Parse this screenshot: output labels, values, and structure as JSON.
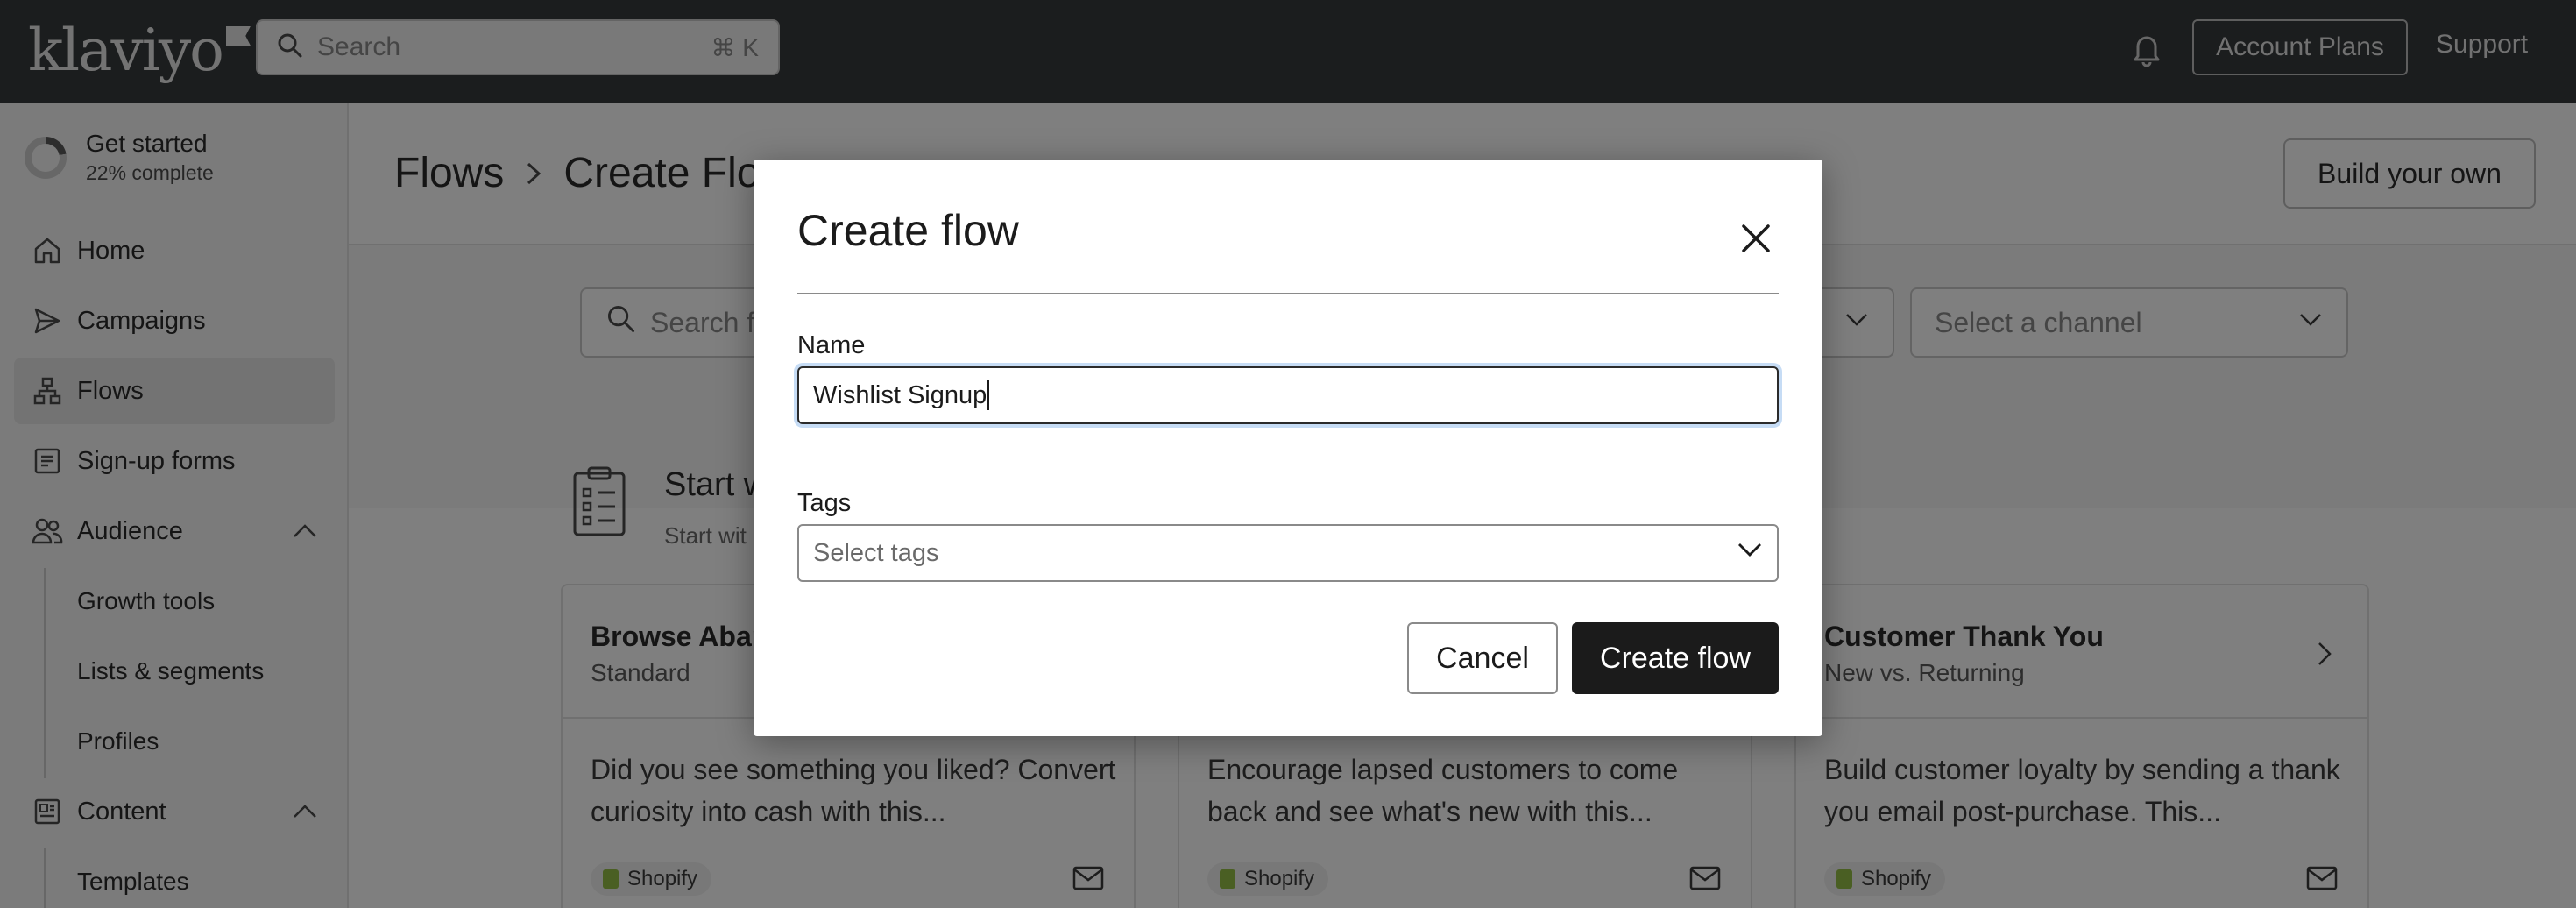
{
  "topbar": {
    "logo_text": "klaviyo",
    "search_placeholder": "Search",
    "search_shortcut": "⌘ K",
    "account_plans_label": "Account Plans",
    "support_label": "Support",
    "icons": {
      "search": "search-icon",
      "bell": "bell-icon"
    }
  },
  "sidebar": {
    "get_started": {
      "title": "Get started",
      "subtitle": "22% complete",
      "progress": 0.22
    },
    "items": [
      {
        "label": "Home",
        "icon": "home-icon"
      },
      {
        "label": "Campaigns",
        "icon": "send-icon"
      },
      {
        "label": "Flows",
        "icon": "flows-icon",
        "active": true
      },
      {
        "label": "Sign-up forms",
        "icon": "form-icon"
      },
      {
        "label": "Audience",
        "icon": "audience-icon",
        "expanded": true
      },
      {
        "label": "Content",
        "icon": "content-icon",
        "expanded": true
      }
    ],
    "audience_sub": [
      "Growth tools",
      "Lists & segments",
      "Profiles"
    ],
    "content_sub": [
      "Templates"
    ]
  },
  "main": {
    "breadcrumb": [
      "Flows",
      "Create Flo"
    ],
    "build_own_label": "Build your own",
    "filters": {
      "search_placeholder": "Search f",
      "dropdown1_partial": "s",
      "channel_placeholder": "Select a channel"
    },
    "start_title": "Start w",
    "start_sub": "Start wit",
    "cards": [
      {
        "title": "Browse Abar",
        "subtitle": "Standard",
        "desc": "Did you see something you liked? Convert curiosity into cash with this...",
        "badge": "Shopify"
      },
      {
        "title": "",
        "subtitle": "",
        "desc": "Encourage lapsed customers to come back and see what's new with this...",
        "badge": "Shopify"
      },
      {
        "title": "Customer Thank You",
        "subtitle": "New vs. Returning",
        "desc": "Build customer loyalty by sending a thank you email post-purchase. This...",
        "badge": "Shopify"
      }
    ]
  },
  "modal": {
    "title": "Create flow",
    "name_label": "Name",
    "name_value": "Wishlist Signup",
    "tags_label": "Tags",
    "tags_placeholder": "Select tags",
    "cancel_label": "Cancel",
    "create_label": "Create flow"
  },
  "colors": {
    "topbar": "#373a3c",
    "overlay": "rgba(0,0,0,0.5)",
    "primary_button": "#1b1b1b",
    "focus_ring": "#c6dcf5",
    "shopify_green": "#95bf47"
  }
}
